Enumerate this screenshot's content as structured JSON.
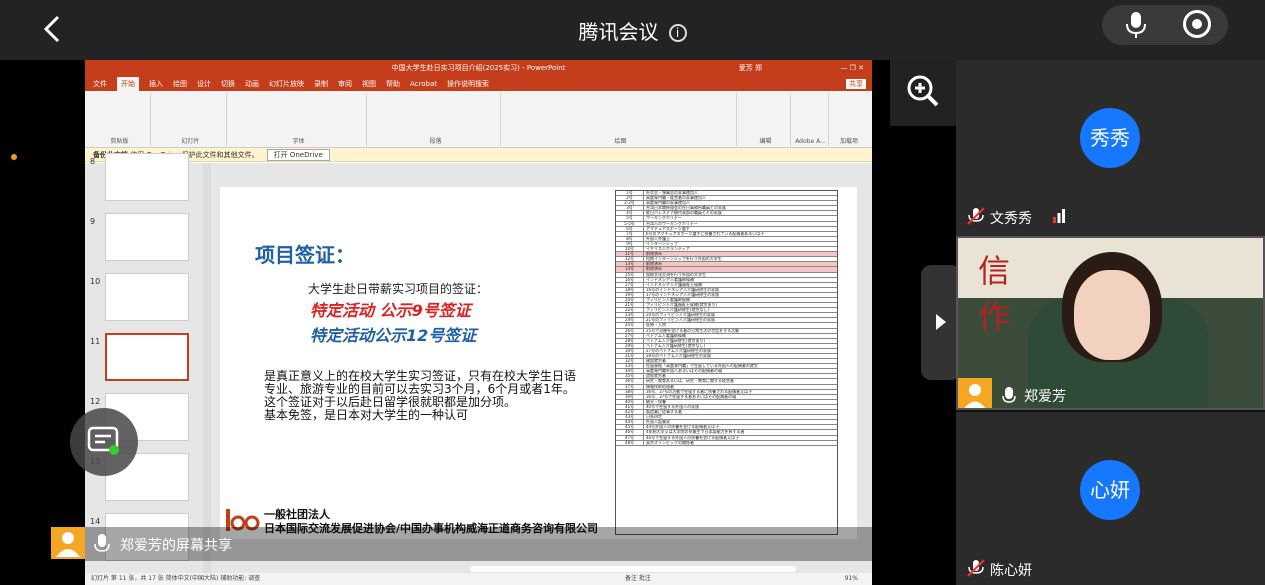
{
  "header": {
    "title": "腾讯会议",
    "info_icon": "info-icon",
    "back_icon": "back-chevron-icon",
    "mic_icon": "microphone-icon",
    "record_icon": "record-icon"
  },
  "ppt": {
    "window_title": "中国大学生赴日实习项目介绍(2025实习) - PowerPoint",
    "user": "爱芳 郑",
    "share_label": "共享",
    "tabs": [
      "文件",
      "开始",
      "插入",
      "绘图",
      "设计",
      "切换",
      "动画",
      "幻灯片放映",
      "录制",
      "审阅",
      "视图",
      "帮助",
      "Acrobat",
      "操作说明搜索"
    ],
    "active_tab": "开始",
    "ribbon_groups": [
      "剪贴板",
      "幻灯片",
      "字体",
      "段落",
      "绘图",
      "编辑",
      "Adobe A...",
      "加载项"
    ],
    "notify_label": "备份此文档",
    "notify_text": "使用 OneDrive 保护此文件和其他文件。",
    "notify_button": "打开 OneDrive",
    "thumb_numbers": [
      "8",
      "9",
      "10",
      "11",
      "12",
      "13",
      "14"
    ],
    "selected_thumb": "11",
    "status": "幻灯片 第 11 张，共 17 张    简体中文(中国大陆)    辅助功能: 调查",
    "status_right": "备注   批注",
    "zoom": "91%"
  },
  "slide": {
    "heading": "项目签证：",
    "subtitle": "大学生赴日带薪实习项目的签证：",
    "red_line": "特定活动 公示9号签证",
    "blue_line": "特定活动公示12号签证",
    "body": [
      "是真正意义上的在校大学生实习签证，只有在校大学生日语",
      "专业、旅游专业的目前可以去实习3个月，6个月或者1年。",
      "这个签证对于以后赴日留学很就职都是加分项。",
      "基本免签，是日本对大学生的一种认可"
    ],
    "org_line1": "一般社团法人",
    "org_line2": "日本国际交流发展促进协会/中国办事机构威海正道商务咨询有限公司",
    "table_rows": [
      {
        "n": "1号",
        "t": "外交官・領事官の家事使用人",
        "pink": false
      },
      {
        "n": "2号",
        "t": "高度専門職・経営者の家事使用人",
        "pink": false
      },
      {
        "n": "2-2号",
        "t": "高度専門職の家事使用人",
        "pink": false
      },
      {
        "n": "3号",
        "t": "台湾日本関係協会の在日事務所職員との家族",
        "pink": false
      },
      {
        "n": "4号",
        "t": "駐日パレスチナ総代表部の職員とその家族",
        "pink": false
      },
      {
        "n": "5号",
        "t": "ワーキングホリデー",
        "pink": false
      },
      {
        "n": "5-5号",
        "t": "台湾人のワーキングホリデー",
        "pink": false
      },
      {
        "n": "6号",
        "t": "アマチュアスポーツ選手",
        "pink": false
      },
      {
        "n": "7号",
        "t": "6号のアマチュアスポーツ選手に扶養されている配偶者あるいは子",
        "pink": false
      },
      {
        "n": "8号",
        "t": "外国人弁護士",
        "pink": false
      },
      {
        "n": "9号",
        "t": "インターンシップ",
        "pink": false
      },
      {
        "n": "10号",
        "t": "イギリス人ボランティア",
        "pink": false
      },
      {
        "n": "11号",
        "t": "削除済み",
        "pink": true
      },
      {
        "n": "12号",
        "t": "短期インターンシップを行う外国の大学生",
        "pink": false
      },
      {
        "n": "13号",
        "t": "削除済み",
        "pink": true
      },
      {
        "n": "14号",
        "t": "削除済み",
        "pink": true
      },
      {
        "n": "15号",
        "t": "国際文化交流を行う外国の大学生",
        "pink": false
      },
      {
        "n": "16号",
        "t": "インドネシア人看護師候補",
        "pink": false
      },
      {
        "n": "17号",
        "t": "インドネシア人介護福祉士候補",
        "pink": false
      },
      {
        "n": "18号",
        "t": "16号のインドネシア人介護研修生の家族",
        "pink": false
      },
      {
        "n": "19号",
        "t": "17号のインドネシア人介護研修生の家族",
        "pink": false
      },
      {
        "n": "20号",
        "t": "フィリピン人看護師候補",
        "pink": false
      },
      {
        "n": "21号",
        "t": "フィリピン人介護福祉士候補(就労あり)",
        "pink": false
      },
      {
        "n": "22号",
        "t": "フィリピン人介護研修生(就労なし)",
        "pink": false
      },
      {
        "n": "23号",
        "t": "20号のフィリピン人介護研修生の家族",
        "pink": false
      },
      {
        "n": "24号",
        "t": "21号のフィリピン人介護研修生の家族",
        "pink": false
      },
      {
        "n": "25号",
        "t": "医療・入院",
        "pink": false
      },
      {
        "n": "26号",
        "t": "25号で治療を受ける者の日常生活の世話をする活動",
        "pink": false
      },
      {
        "n": "27号",
        "t": "ベトナム人看護師候補",
        "pink": false
      },
      {
        "n": "28号",
        "t": "ベトナム人介護研修生(就労あり)",
        "pink": false
      },
      {
        "n": "29号",
        "t": "ベトナム人介護研修生(就労なし)",
        "pink": false
      },
      {
        "n": "30号",
        "t": "27号のベトナム人介護研修生の家族",
        "pink": false
      },
      {
        "n": "31号",
        "t": "28号のベトナム人介護研修生の家族",
        "pink": false
      },
      {
        "n": "32号",
        "t": "建設就労者",
        "pink": false
      },
      {
        "n": "33号",
        "t": "在留資格「高度専門職」で在留している外国人の配偶者の就労",
        "pink": false
      },
      {
        "n": "34号",
        "t": "高度専門職外国人あるいはその配偶者の親",
        "pink": false
      },
      {
        "n": "35号",
        "t": "造船就労者",
        "pink": false
      },
      {
        "n": "36号",
        "t": "研究・教育あるいは、研究・教育に関する経営者",
        "pink": false
      },
      {
        "n": "37号",
        "t": "情報技術処理者",
        "pink": false
      },
      {
        "n": "38号",
        "t": "36号、37号の活動で在留する者に扶養される配偶者又は子",
        "pink": false
      },
      {
        "n": "39号",
        "t": "36号、37号で在留する者あるいはその配偶者の親",
        "pink": false
      },
      {
        "n": "40号",
        "t": "観光・保養",
        "pink": false
      },
      {
        "n": "41号",
        "t": "40号で在留する外国人の家族",
        "pink": false
      },
      {
        "n": "42号",
        "t": "製造業に従事する者",
        "pink": false
      },
      {
        "n": "43号",
        "t": "日系四世",
        "pink": false
      },
      {
        "n": "44号",
        "t": "外国人起業家",
        "pink": false
      },
      {
        "n": "45号",
        "t": "44号外国人の扶養を受ける配偶者又は子",
        "pink": false
      },
      {
        "n": "46号",
        "t": "4年制大学又は大学院の卒業生で日本語能力を有する者",
        "pink": false
      },
      {
        "n": "47号",
        "t": "46号で在留する外国人の扶養を受ける配偶者又は子",
        "pink": false
      },
      {
        "n": "48号",
        "t": "東京オリンピックの関係者",
        "pink": false
      }
    ]
  },
  "share_bar": {
    "label": "郑爱芳的屏幕共享"
  },
  "participants": [
    {
      "name": "文秀秀",
      "avatar_text": "秀秀",
      "muted": true
    },
    {
      "name": "郑爱芳",
      "muted": false,
      "video": true,
      "banner": "信 愚 作 赢"
    },
    {
      "name": "陈心妍",
      "avatar_text": "心妍",
      "muted": true
    }
  ],
  "colors": {
    "accent": "#1677ff",
    "ppt": "#c43e1c",
    "background": "#232323"
  }
}
